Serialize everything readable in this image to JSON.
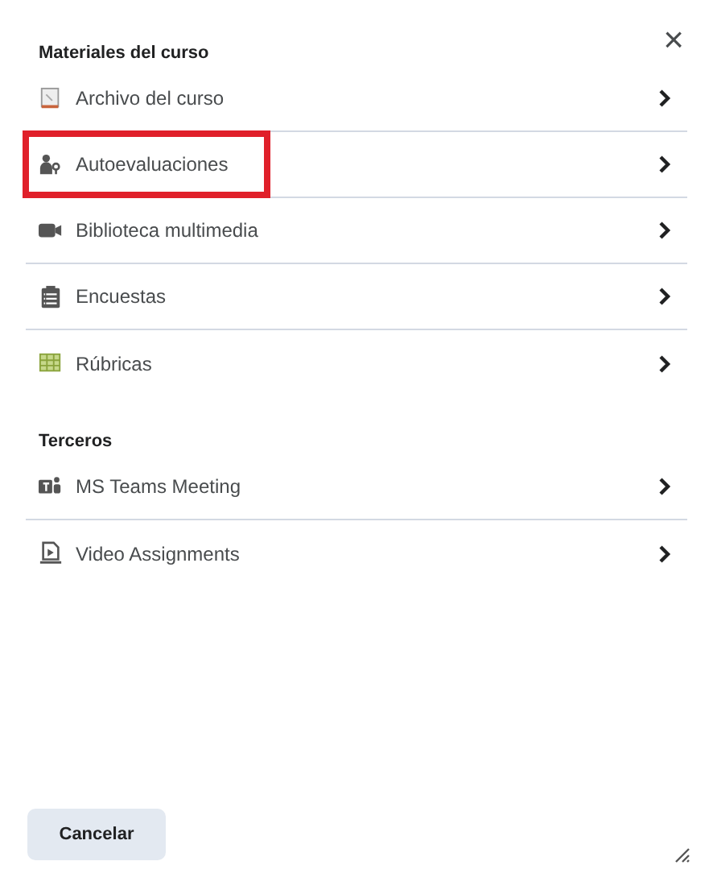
{
  "close_button": "×",
  "sections": [
    {
      "title": "Materiales del curso",
      "items": [
        {
          "label": "Archivo del curso",
          "kind": "file",
          "highlighted": false
        },
        {
          "label": "Autoevaluaciones",
          "kind": "person",
          "highlighted": true
        },
        {
          "label": "Biblioteca multimedia",
          "kind": "camera",
          "highlighted": false
        },
        {
          "label": "Encuestas",
          "kind": "clipboard",
          "highlighted": false
        },
        {
          "label": "Rúbricas",
          "kind": "grid",
          "highlighted": false
        }
      ]
    },
    {
      "title": "Terceros",
      "items": [
        {
          "label": "MS Teams Meeting",
          "kind": "teams",
          "highlighted": false
        },
        {
          "label": "Video Assignments",
          "kind": "video",
          "highlighted": false
        }
      ]
    }
  ],
  "cancel_button": "Cancelar"
}
